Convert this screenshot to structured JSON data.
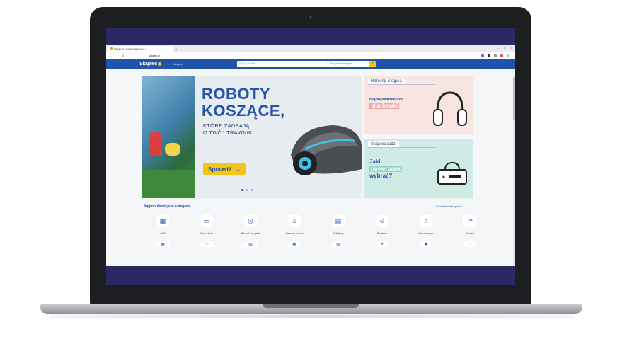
{
  "browser": {
    "tab_title": "Skapiec.pl - porownywarka cen",
    "tab_close": "×",
    "new_tab": "+",
    "url": "skapiec.pl",
    "window_controls": [
      "–",
      "□",
      "×"
    ]
  },
  "header": {
    "logo": "Skapiec",
    "categories_link": "Kategorie",
    "search_placeholder": "Znajdź produkt",
    "category_select": "Wszystkie kategorie",
    "search_icon": "search-icon"
  },
  "hero": {
    "title_line1": "ROBOTY",
    "title_line2": "KOSZĄCE,",
    "subtitle_line1": "KTÓRE ZADBAJĄ",
    "subtitle_line2": "O TWÓJ TRAWNIK",
    "cta": "Sprawdź",
    "cta_arrow": "→"
  },
  "cards": [
    {
      "tag": "Ranking Skąpca",
      "line1": "Najpopularniejsze",
      "highlight": "słuchawki"
    },
    {
      "tag": "Skąpiec radzi",
      "line1": "Jaki",
      "highlight": "powerbank",
      "line3": "wybrać?"
    }
  ],
  "section": {
    "title": "Najpopularniejsze kategorie",
    "all_link": "Wszystkie kategorie",
    "all_arrow": "→"
  },
  "categories": [
    {
      "label": "AGD",
      "icon": "▦"
    },
    {
      "label": "Biuro i firma",
      "icon": "▭"
    },
    {
      "label": "Biżuteria i zegarki",
      "icon": "◎"
    },
    {
      "label": "Budowa i remont",
      "icon": "⌂"
    },
    {
      "label": "Delikatesy",
      "icon": "▤"
    },
    {
      "label": "Dla dzieci",
      "icon": "☺"
    },
    {
      "label": "Dom i wnętrze",
      "icon": "⌂"
    },
    {
      "label": "Erotyka",
      "icon": "18+"
    }
  ],
  "categories_row2": [
    {
      "icon": "▦"
    },
    {
      "icon": "◠"
    },
    {
      "icon": "▥"
    },
    {
      "icon": "▣"
    },
    {
      "icon": "▧"
    },
    {
      "icon": "◒"
    },
    {
      "icon": "◆"
    },
    {
      "icon": "◠"
    }
  ],
  "colors": {
    "brand_blue": "#2153a8",
    "accent_yellow": "#f5c518",
    "screen_frame": "#2c2864"
  }
}
